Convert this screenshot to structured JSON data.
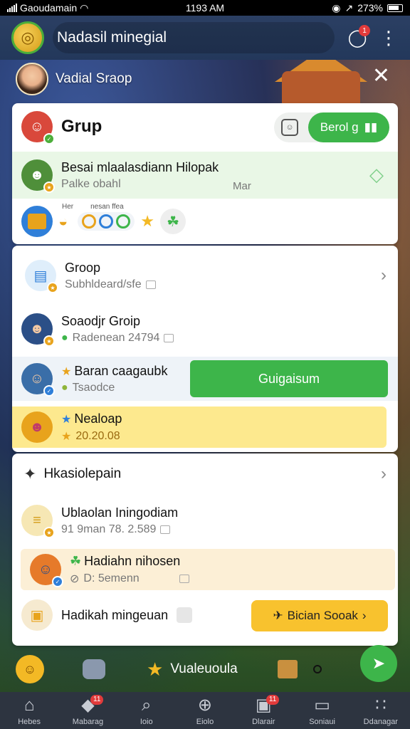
{
  "status_bar": {
    "carrier": "Gaoudamain",
    "time": "1193 AM",
    "battery": "273%"
  },
  "header": {
    "title": "Nadasil minegial",
    "notification_count": "1"
  },
  "profile": {
    "name": "Vadial Sraop"
  },
  "card_group": {
    "title": "Grup",
    "join_label": "Berol g",
    "highlight": {
      "title": "Besai mlaalasdiann Hilopak",
      "subtitle": "Palke obahl",
      "tag": "Mar"
    },
    "mini_labels": [
      "Her",
      "nesan ffea"
    ]
  },
  "card_list": {
    "items": [
      {
        "title": "Groop",
        "subtitle": "Subhldeard/sfe"
      },
      {
        "title": "Soaodjr Groip",
        "subtitle": "Radenean 24794"
      },
      {
        "title": "Baran caagaubk",
        "subtitle": "Tsaodce",
        "action": "Guigaisum"
      },
      {
        "title": "Nealoap",
        "subtitle": "20.20.08"
      }
    ]
  },
  "card_activity": {
    "title": "Hkasiolepain",
    "items": [
      {
        "title": "Ublaolan Iningodiam",
        "subtitle": "91 9man 78. 2.589"
      },
      {
        "title": "Hadiahn nihosen",
        "subtitle": "D: 5emenn"
      },
      {
        "title": "Hadikah mingeuan",
        "action": "Bician Sooak"
      }
    ]
  },
  "bottom_strip": {
    "label": "Vualeuoula"
  },
  "tabs": [
    {
      "label": "Hebes",
      "count": ""
    },
    {
      "label": "Mabarag",
      "count": "11"
    },
    {
      "label": "Ioio",
      "count": ""
    },
    {
      "label": "Eiolo",
      "count": ""
    },
    {
      "label": "Dlarair",
      "count": "11"
    },
    {
      "label": "Soniaui",
      "count": ""
    },
    {
      "label": "Ddanagar",
      "count": ""
    }
  ],
  "colors": {
    "accent_green": "#3db54a",
    "accent_yellow": "#f8c22e",
    "header_bg": "#2b3f63",
    "tabbar_bg": "#2d3440",
    "badge_red": "#e23b3b"
  }
}
